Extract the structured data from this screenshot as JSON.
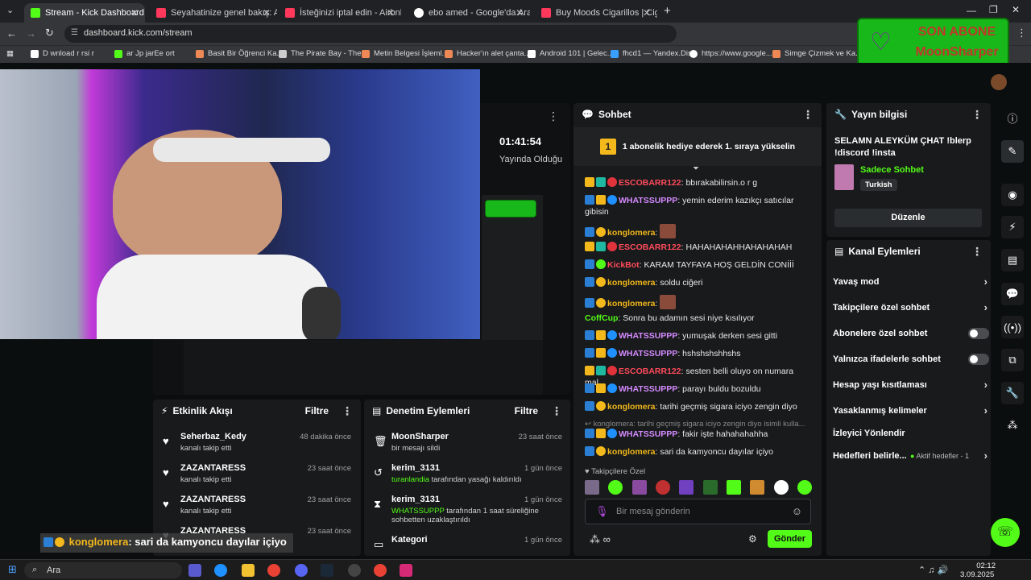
{
  "browser": {
    "tabs": [
      {
        "title": "Stream - Kick Dashboard",
        "active": true,
        "color": "#53fc18"
      },
      {
        "title": "Seyahatinize genel bakış: Airbnb",
        "active": false,
        "color": "#ff385c"
      },
      {
        "title": "İsteğinizi iptal edin - Airbnb",
        "active": false,
        "color": "#ff385c"
      },
      {
        "title": "ebo amed - Google'da Ara",
        "active": false,
        "color": "#ffffff"
      },
      {
        "title": "Buy Moods Cigarillos | Cigarwo",
        "active": false,
        "color": "#ff385c"
      }
    ],
    "new_tab": "+",
    "url": "dashboard.kick.com/stream",
    "bookmarks": [
      "D  wnload  r  rsi  r",
      "  ar  Jp  jarEe  ort",
      "Basit Bir Öğrenci Ka...",
      "The Pirate Bay - The...",
      "Metin Belgesi İşleml...",
      "Hacker'ın alet çanta...",
      "Android 101 | Gelec...",
      "fhcd1 — Yandex.Disk",
      "https://www.google...",
      "Simge Çizmek ve Ka..."
    ]
  },
  "overlay": {
    "label": "SON ABONE",
    "name": "MoonSharper",
    "bg": "#18b81a"
  },
  "stream_info": {
    "uptime": "01:41:54",
    "uptime_label": "Yayında Olduğu"
  },
  "chat": {
    "title": "Sohbet",
    "banner": "1 abonelik hediye ederek 1. sıraya yükselin",
    "messages": [
      {
        "user": "ESCOBARR122",
        "color": "red",
        "text": ": bbırakabilirsin.o r g"
      },
      {
        "user": "WHATSSUPPP",
        "color": "pink",
        "text": ": yemin ederim kazıkçı satıcılar gibisin"
      },
      {
        "user": "konglomera",
        "color": "yellow",
        "text": ":"
      },
      {
        "user": "ESCOBARR122",
        "color": "red",
        "text": ": HAHAHAHAHHAHAHAHAH"
      },
      {
        "user": "KickBot",
        "color": "red",
        "text": ": KARAM TAYFAYA HOŞ GELDİN CONİİİ"
      },
      {
        "user": "konglomera",
        "color": "yellow",
        "text": ": soldu ciğeri"
      },
      {
        "user": "konglomera",
        "color": "yellow",
        "text": ":"
      },
      {
        "user": "CoffCup",
        "color": "green",
        "text": ": Sonra bu adamın sesi niye kısılıyor"
      },
      {
        "user": "WHATSSUPPP",
        "color": "pink",
        "text": ": yumuşak derken sesi gitti"
      },
      {
        "user": "WHATSSUPPP",
        "color": "pink",
        "text": ": hshshshshhshs"
      },
      {
        "user": "ESCOBARR122",
        "color": "red",
        "text": ": sesten belli oluyo on numara mal"
      },
      {
        "user": "WHATSSUPPP",
        "color": "pink",
        "text": ": parayı buldu bozuldu"
      },
      {
        "user": "konglomera",
        "color": "yellow",
        "text": ": tarihi geçmiş sigara iciyo zengin diyo"
      },
      {
        "user": "WHATSSUPPP",
        "color": "pink",
        "text": ": fakir işte hahahahahha"
      },
      {
        "user": "konglomera",
        "color": "yellow",
        "text": ": sari da kamyoncu dayılar içiyo"
      }
    ],
    "reply_preview": "konglomera: tarihi geçmiş sigara iciyo zengin diyo isimli kulla...",
    "followers_only": "Takipçilere Özel",
    "input_placeholder": "Bir mesaj gönderin",
    "send_label": "Gönder"
  },
  "stream_info_panel": {
    "title": "Yayın bilgisi",
    "stream_title": "SELAMN ALEYKÜM ÇHAT !blerp !discord !insta",
    "category": "Sadece Sohbet",
    "language": "Turkish",
    "edit_label": "Düzenle"
  },
  "channel_actions": {
    "title": "Kanal Eylemleri",
    "items": [
      {
        "label": "Yavaş mod",
        "kind": "chevron"
      },
      {
        "label": "Takipçilere özel sohbet",
        "kind": "chevron"
      },
      {
        "label": "Abonelere özel sohbet",
        "kind": "toggle"
      },
      {
        "label": "Yalnızca ifadelerle sohbet",
        "kind": "toggle"
      },
      {
        "label": "Hesap yaşı kısıtlaması",
        "kind": "chevron"
      },
      {
        "label": "Yasaklanmış kelimeler",
        "kind": "chevron"
      },
      {
        "label": "İzleyici Yönlendir",
        "kind": "none"
      },
      {
        "label": "Hedefleri belirle...",
        "kind": "chevron",
        "extra": "Aktif hedefler - 1"
      }
    ]
  },
  "activity_feed": {
    "title": "Etkinlik Akışı",
    "filter": "Filtre",
    "items": [
      {
        "name": "Seherbaz_Kedy",
        "time": "48 dakika önce",
        "desc": "kanalı takip etti"
      },
      {
        "name": "ZAZANTARESS",
        "time": "23 saat önce",
        "desc": "kanalı takip etti"
      },
      {
        "name": "ZAZANTARESS",
        "time": "23 saat önce",
        "desc": "kanalı takip etti"
      },
      {
        "name": "ZAZANTARESS",
        "time": "23 saat önce",
        "desc": ""
      }
    ]
  },
  "moderation": {
    "title": "Denetim Eylemleri",
    "filter": "Filtre",
    "items": [
      {
        "name": "MoonSharper",
        "time": "23 saat önce",
        "highlight": "",
        "desc": "bir mesajı sildi"
      },
      {
        "name": "kerim_3131",
        "time": "1 gün önce",
        "highlight": "turanlandia",
        "desc": " tarafından yasağı kaldırıldı"
      },
      {
        "name": "kerim_3131",
        "time": "1 gün önce",
        "highlight": "WHATSSUPPP",
        "desc": " tarafından 1 saat süreliğine sohbetten uzaklaştırıldı"
      },
      {
        "name": "Kategori",
        "time": "1 gün önce",
        "highlight": "",
        "desc": ""
      }
    ]
  },
  "caption": {
    "user": "konglomera",
    "text": ": sari da kamyoncu dayılar içiyo"
  },
  "taskbar": {
    "search": "Ara",
    "time": "02:12",
    "date": "3.09.2025"
  }
}
